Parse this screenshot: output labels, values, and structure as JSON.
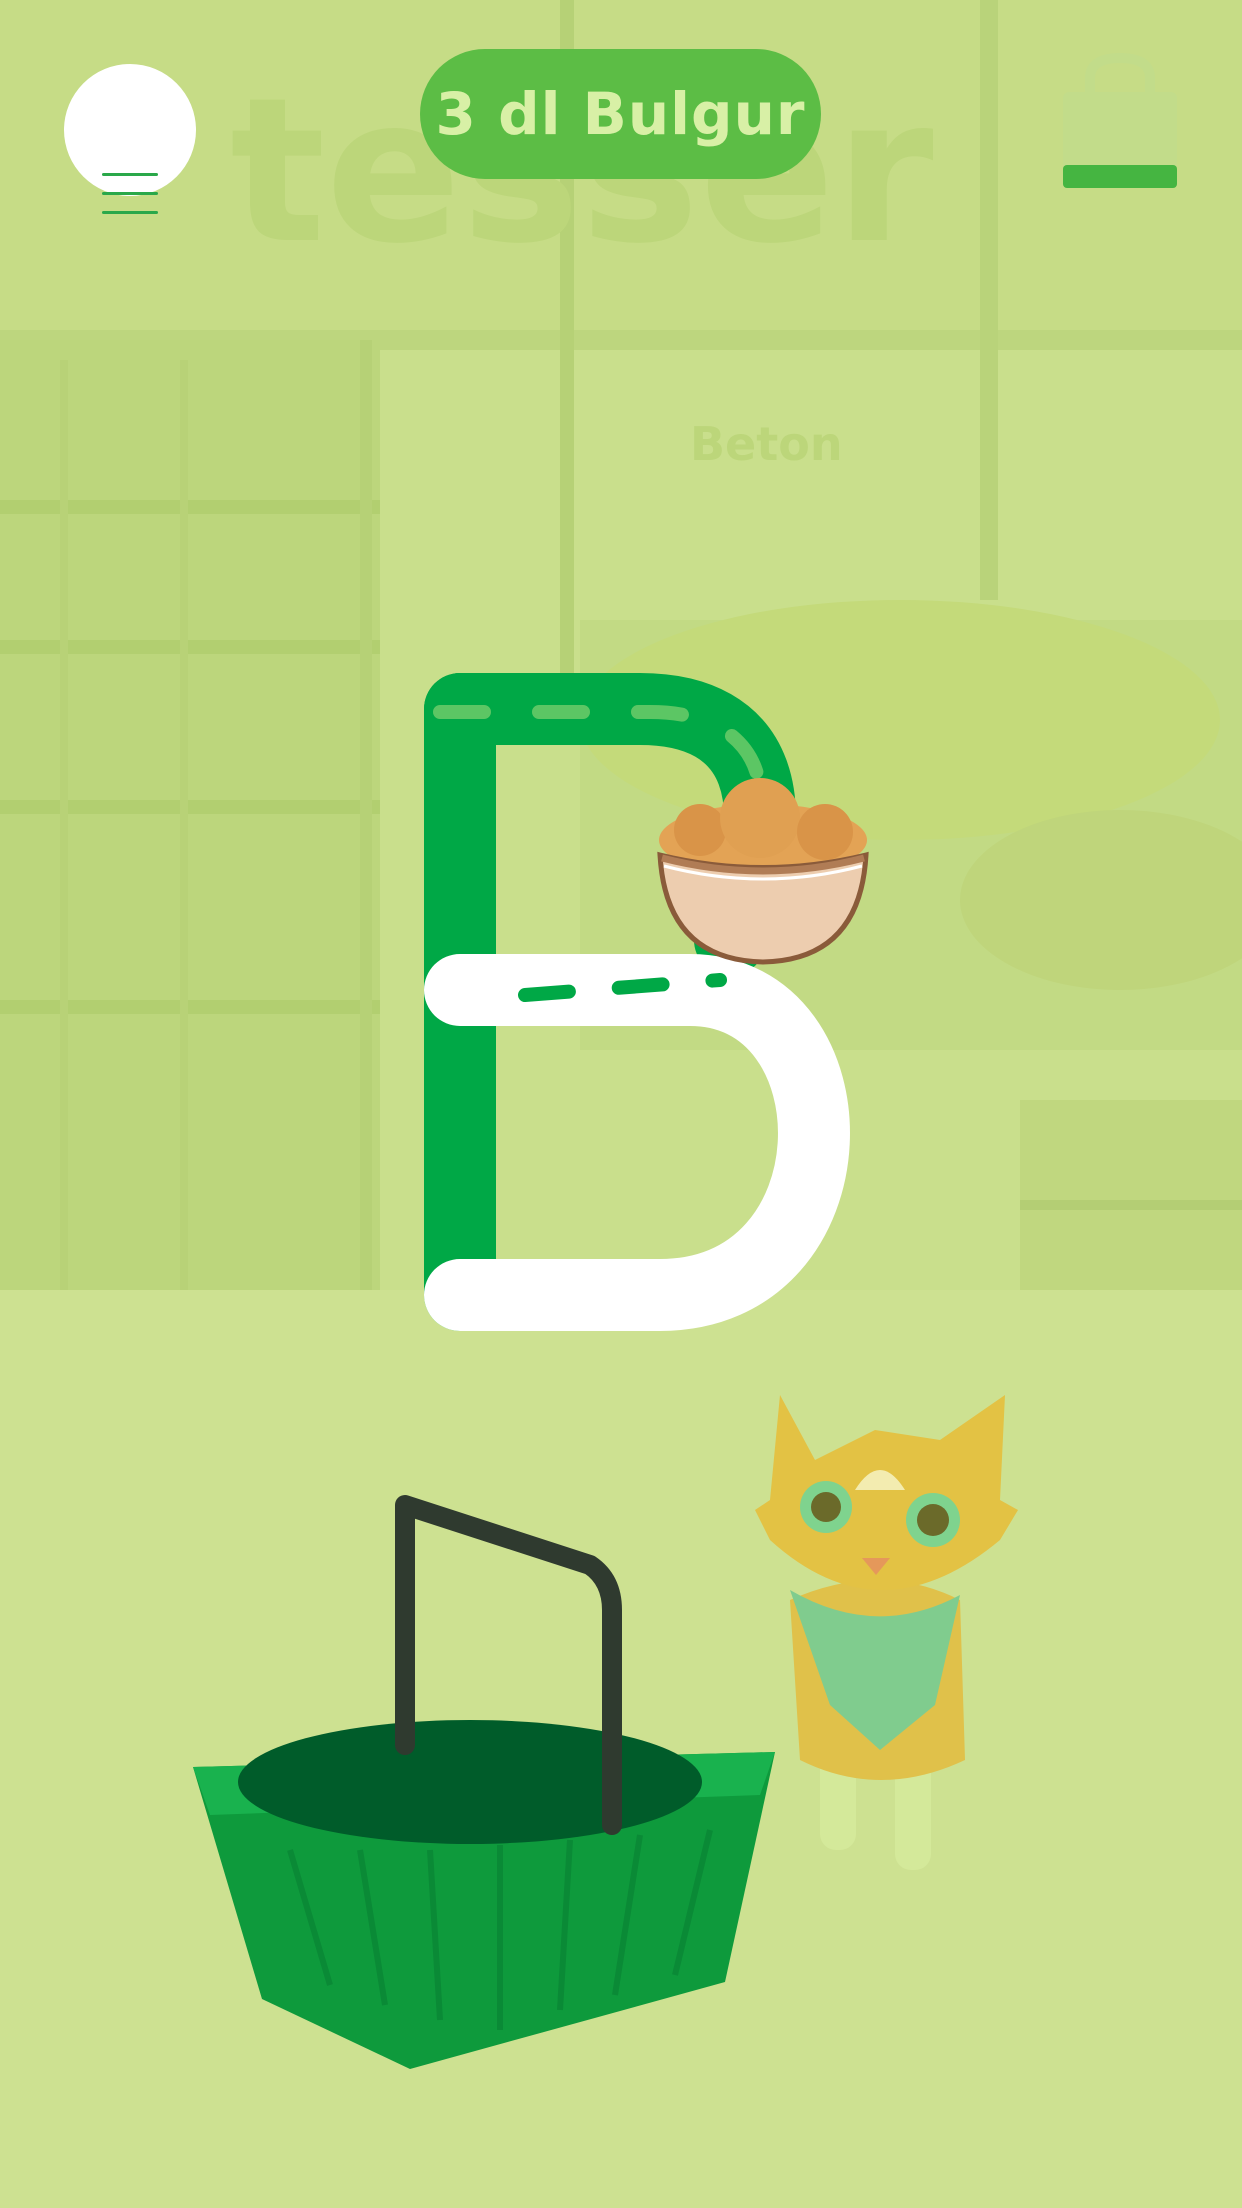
{
  "header": {
    "title": "3 dl Bulgur",
    "menu_icon": "hamburger-menu-icon",
    "bag_icon": "shopping-bag-icon"
  },
  "game": {
    "letter": "B",
    "item_icon": "bulgur-bowl-icon",
    "basket_icon": "shopping-basket-icon",
    "mascot_icon": "cat-mascot-icon"
  },
  "background": {
    "sign_text": "tesser",
    "shelf_text": "Beton"
  },
  "colors": {
    "overlay": "#c9df8c",
    "accent_green": "#00a846",
    "pill_green": "#5cbd45",
    "pill_text": "#d8f0a6"
  }
}
